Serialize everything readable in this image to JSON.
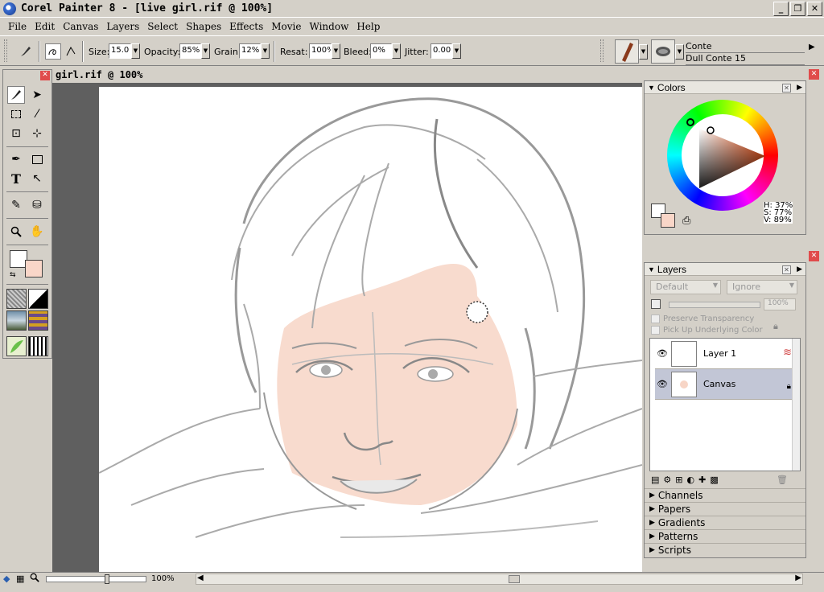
{
  "window": {
    "title": "Corel Painter 8 - [live girl.rif @ 100%]",
    "controls": [
      "_",
      "❐",
      "✕"
    ]
  },
  "menu": [
    "File",
    "Edit",
    "Canvas",
    "Layers",
    "Select",
    "Shapes",
    "Effects",
    "Movie",
    "Window",
    "Help"
  ],
  "property_bar": {
    "size_label": "Size:",
    "size_value": "15.0",
    "opacity_label": "Opacity:",
    "opacity_value": "85%",
    "grain_label": "Grain:",
    "grain_value": "12%",
    "resat_label": "Resat:",
    "resat_value": "100%",
    "bleed_label": "Bleed:",
    "bleed_value": "0%",
    "jitter_label": "Jitter:",
    "jitter_value": "0.00",
    "brush_category": "Conte",
    "brush_variant": "Dull Conte 15"
  },
  "document": {
    "title": "girl.rif @ 100%"
  },
  "colors_palette": {
    "title": "Colors",
    "h": "H: 37%",
    "s": "S: 77%",
    "v": "V: 89%",
    "main_color": "#ffffff",
    "secondary_color": "#f9d6c8"
  },
  "layers_palette": {
    "title": "Layers",
    "composite_method": "Default",
    "depth_method": "Ignore",
    "opacity": "100%",
    "preserve_transparency": "Preserve Transparency",
    "pick_up_underlying": "Pick Up Underlying Color",
    "layers": [
      {
        "name": "Layer 1",
        "selected": false
      },
      {
        "name": "Canvas",
        "selected": true
      }
    ]
  },
  "collapsed_palettes": [
    "Channels",
    "Papers",
    "Gradients",
    "Patterns",
    "Scripts"
  ],
  "status": {
    "zoom": "100%"
  }
}
